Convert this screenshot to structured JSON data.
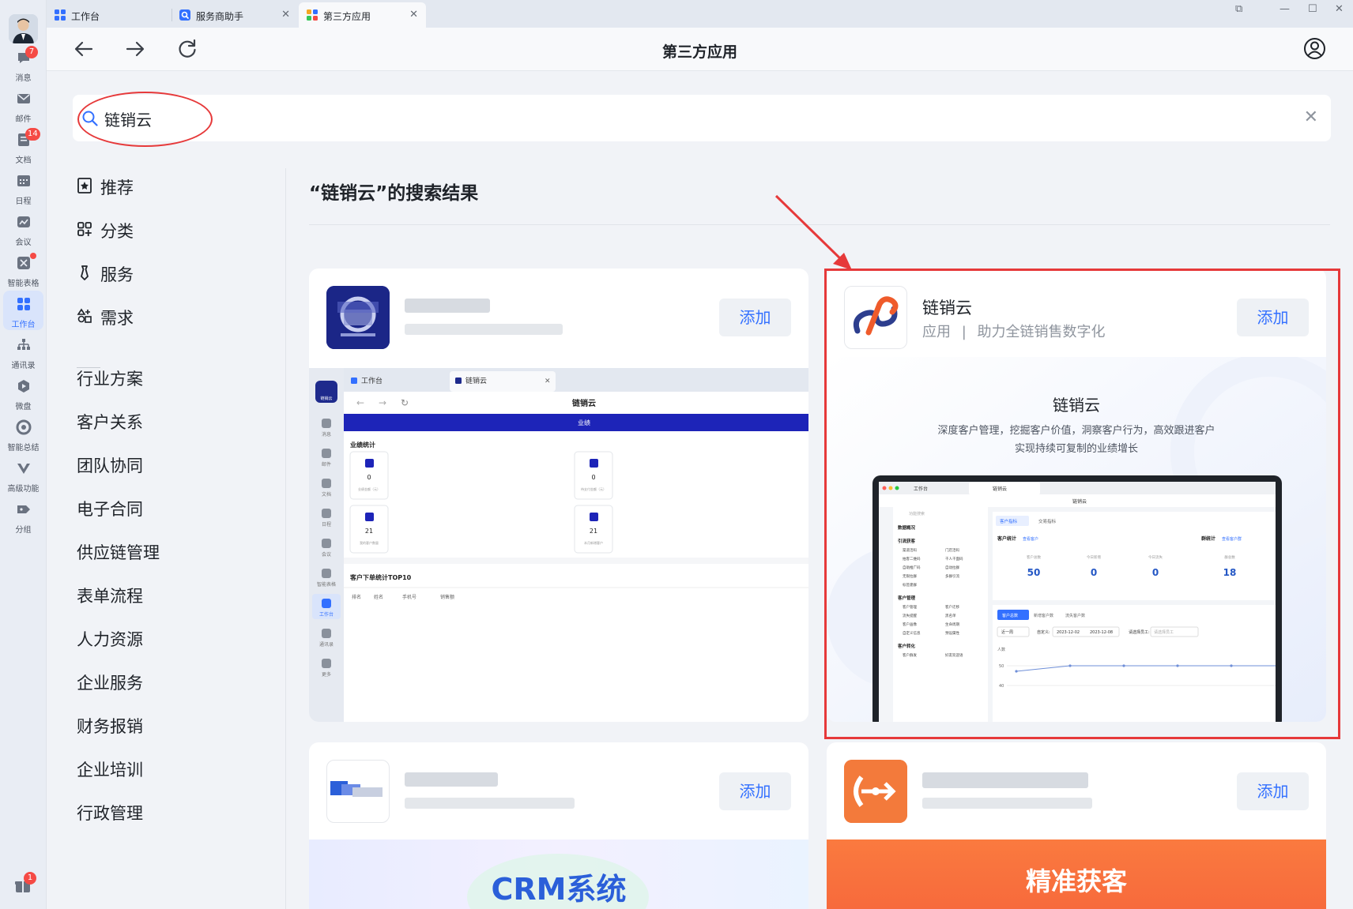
{
  "tabs": [
    {
      "label": "工作台",
      "closable": false,
      "active": false
    },
    {
      "label": "服务商助手",
      "closable": true,
      "active": false
    },
    {
      "label": "第三方应用",
      "closable": true,
      "active": true
    }
  ],
  "rail": [
    {
      "label": "消息",
      "icon": "chat-icon",
      "badge": "7"
    },
    {
      "label": "邮件",
      "icon": "mail-icon"
    },
    {
      "label": "文档",
      "icon": "doc-icon",
      "badge": "14"
    },
    {
      "label": "日程",
      "icon": "calendar-icon"
    },
    {
      "label": "会议",
      "icon": "meeting-icon"
    },
    {
      "label": "智能表格",
      "icon": "smart-table-icon",
      "dot": true
    },
    {
      "label": "工作台",
      "icon": "workbench-icon",
      "active": true
    },
    {
      "label": "通讯录",
      "icon": "contacts-icon"
    },
    {
      "label": "微盘",
      "icon": "drive-icon"
    },
    {
      "label": "智能总结",
      "icon": "summary-icon"
    },
    {
      "label": "高级功能",
      "icon": "advanced-icon"
    },
    {
      "label": "分组",
      "icon": "group-icon"
    }
  ],
  "bottom_badge": "1",
  "page_title": "第三方应用",
  "search": {
    "value": "链销云"
  },
  "categories_top": [
    {
      "label": "推荐",
      "icon": "star-bookmark-icon"
    },
    {
      "label": "分类",
      "icon": "category-grid-icon"
    },
    {
      "label": "服务",
      "icon": "tie-icon"
    },
    {
      "label": "需求",
      "icon": "demand-icon"
    }
  ],
  "categories": [
    "行业方案",
    "客户关系",
    "团队协同",
    "电子合同",
    "供应链管理",
    "表单流程",
    "人力资源",
    "企业服务",
    "财务报销",
    "企业培训",
    "行政管理"
  ],
  "results_title": "“链销云”的搜索结果",
  "add_label": "添加",
  "featured": {
    "name": "链销云",
    "type": "应用",
    "separator": "|",
    "tagline": "助力全链销售数字化",
    "banner_title": "链销云",
    "banner_line1": "深度客户管理，挖掘客户价值，洞察客户行为，高效跟进客户",
    "banner_line2": "实现持续可复制的业绩增长",
    "shot": {
      "tab1": "工作台",
      "tab2": "链销云",
      "title": "链销云",
      "search_placeholder": "功能搜索",
      "menu": [
        "数据概况",
        "引流获客",
        "渠道活码",
        "门店活码",
        "拍客二维码",
        "千人千面码",
        "自助推广码",
        "自动拉群",
        "无限拉群",
        "多群引流",
        "标签建群",
        "客户管理",
        "客户管理",
        "客户迁移",
        "流失提醒",
        "黑名单",
        "客户画像",
        "生命周期",
        "自定义信息",
        "预设属性",
        "客户转化",
        "客户群发",
        "好友欢迎语"
      ],
      "tabs": [
        "客户指标",
        "交易指标"
      ],
      "section1": "客户统计",
      "section1_link": "查看客户",
      "section2": "群统计",
      "section2_link": "查看客户群",
      "stats": [
        {
          "label": "客户总数",
          "value": "50"
        },
        {
          "label": "今日新增",
          "value": "0"
        },
        {
          "label": "今日流失",
          "value": "0"
        },
        {
          "label": "群总数",
          "value": "18"
        }
      ],
      "subtabs": [
        "客户总数",
        "新增客户数",
        "流失客户数"
      ],
      "range": "近一周",
      "custom": "自定义:",
      "date_from": "2023-12-02",
      "date_to": "2023-12-08",
      "employee": "请选择员工:",
      "employee_placeholder": "请选择员工",
      "chart_ylabel": "人数",
      "y_ticks": [
        "50",
        "40"
      ]
    }
  },
  "card1_shot": {
    "tab1": "工作台",
    "tab2": "链销云",
    "title": "链销云",
    "banner": "业绩",
    "section": "业绩统计",
    "stats": [
      {
        "value": "0",
        "label": "业绩金额（元）"
      },
      {
        "value": "0",
        "label": "待支付金额（元）"
      },
      {
        "value": "21",
        "label": "我的客户数量"
      },
      {
        "value": "21",
        "label": "本月新增客户"
      }
    ],
    "top10": "客户下单统计TOP10",
    "cols": [
      "排名",
      "姓名",
      "手机号",
      "销售额"
    ],
    "rail": [
      "消息",
      "邮件",
      "文档",
      "日程",
      "会议",
      "智能表格",
      "工作台",
      "通讯录",
      "更多"
    ],
    "logo_text": "链销云"
  },
  "card3_banner": "CRM系统",
  "card4_banner": "精准获客",
  "colors": {
    "accent": "#3370ff",
    "highlight": "#e6393a",
    "crm": "#2b5fd9",
    "orange": "#f7793f"
  }
}
